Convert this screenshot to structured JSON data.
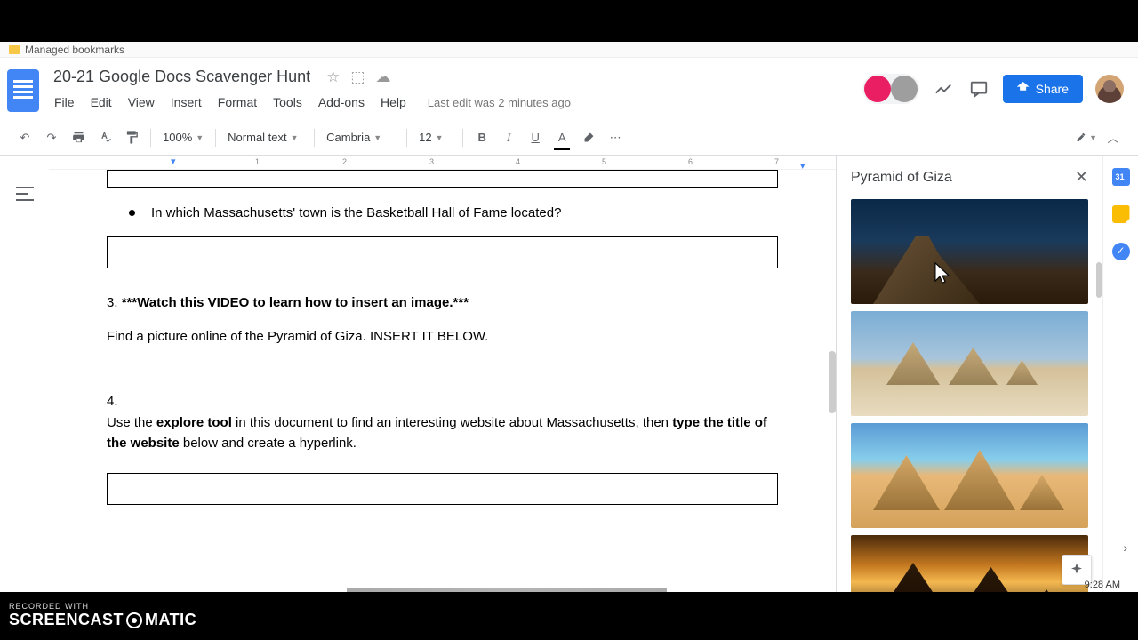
{
  "bookmarks": {
    "managed": "Managed bookmarks"
  },
  "doc": {
    "title": "20-21 Google Docs Scavenger Hunt",
    "last_edit": "Last edit was 2 minutes ago"
  },
  "menu": {
    "file": "File",
    "edit": "Edit",
    "view": "View",
    "insert": "Insert",
    "format": "Format",
    "tools": "Tools",
    "addons": "Add-ons",
    "help": "Help"
  },
  "toolbar": {
    "zoom": "100%",
    "style": "Normal text",
    "font": "Cambria",
    "size": "12"
  },
  "header": {
    "share": "Share"
  },
  "ruler": [
    "1",
    "2",
    "3",
    "4",
    "5",
    "6",
    "7"
  ],
  "content": {
    "bullet_q": "In which Massachusetts' town is the Basketball Hall of Fame located?",
    "q3_label": "3. ",
    "q3_bold": "***Watch this VIDEO to learn how to insert an image.***",
    "q3_instr": " Find a picture online of the Pyramid of Giza. INSERT IT BELOW.",
    "q4_label": "4.",
    "q4_p1a": "Use the ",
    "q4_p1b": "explore tool",
    "q4_p1c": " in this document to find an interesting website about Massachusetts, then ",
    "q4_p1d": "type the title of the website",
    "q4_p1e": " below and create a hyperlink."
  },
  "explore": {
    "title": "Pyramid of Giza"
  },
  "watermark": {
    "recorded": "RECORDED WITH",
    "brand1": "SCREENCAST",
    "brand2": "MATIC"
  },
  "clock": "9:28 AM"
}
